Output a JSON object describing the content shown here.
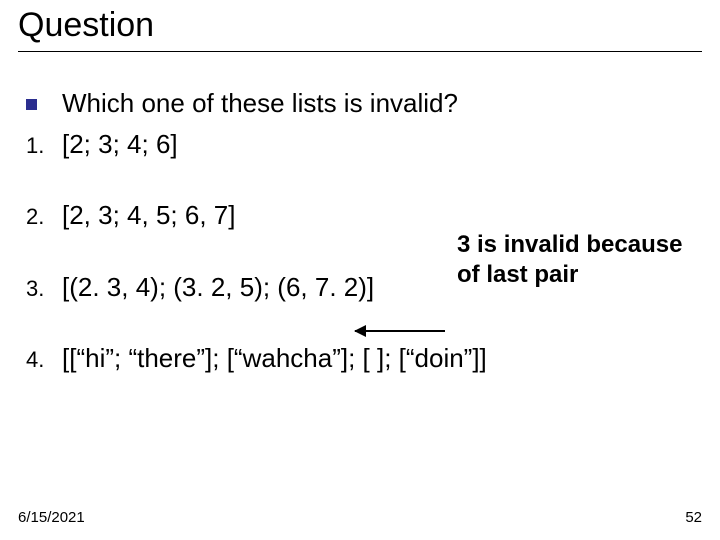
{
  "title": "Question",
  "question": "Which one of these lists is invalid?",
  "items": [
    {
      "num": "1.",
      "text": "[2; 3; 4; 6]"
    },
    {
      "num": "2.",
      "text": "[2, 3; 4, 5; 6, 7]"
    },
    {
      "num": "3.",
      "text": "[(2. 3, 4); (3. 2, 5); (6, 7. 2)]"
    },
    {
      "num": "4.",
      "text": "[[“hi”; “there”]; [“wahcha”]; [ ]; [“doin”]]"
    }
  ],
  "note": "3 is invalid because of last pair",
  "footer": {
    "date": "6/15/2021",
    "page": "52"
  }
}
